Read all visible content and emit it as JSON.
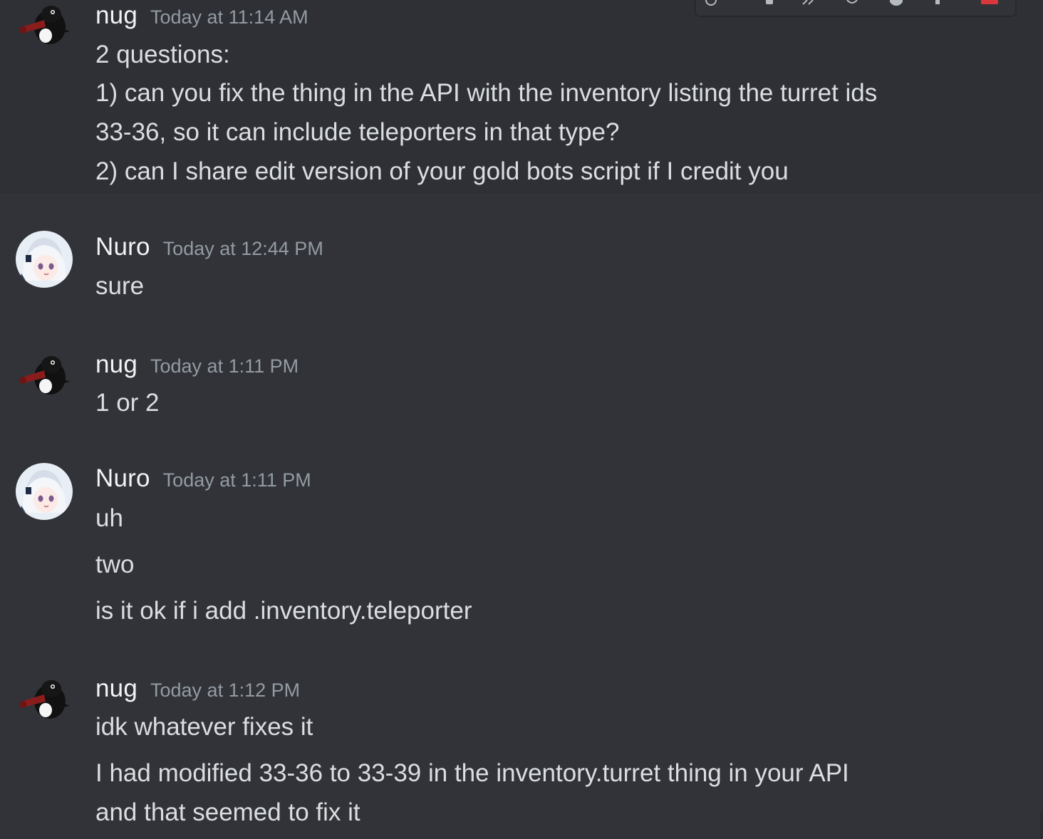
{
  "messages": [
    {
      "author": "nug",
      "timestamp": "Today at 11:14 AM",
      "lines": [
        "2 questions:",
        "1) can you fix the thing in the API with the inventory listing the turret ids",
        "33-36, so it can include teleporters in that type?",
        "2) can I share edit version of your gold bots script if I credit you"
      ]
    },
    {
      "author": "Nuro",
      "timestamp": "Today at 12:44 PM",
      "lines": [
        "sure"
      ]
    },
    {
      "author": "nug",
      "timestamp": "Today at 1:11 PM",
      "lines": [
        "1 or 2"
      ]
    },
    {
      "author": "Nuro",
      "timestamp": "Today at 1:11 PM",
      "lines": [
        "uh",
        "two",
        "is it ok if i add .inventory.teleporter"
      ]
    },
    {
      "author": "nug",
      "timestamp": "Today at 1:12 PM",
      "lines": [
        "idk whatever fixes it",
        "I had modified 33-36 to 33-39 in the inventory.turret thing in your API",
        "and that seemed to fix it"
      ]
    }
  ],
  "icons": {
    "nug_avatar": "penguin-avatar-icon",
    "nuro_avatar": "anime-girl-avatar-icon",
    "toolbar": [
      "add-reaction-icon",
      "edit-icon",
      "thread-icon",
      "reply-icon",
      "more-icon",
      "delete-icon"
    ]
  },
  "colors": {
    "background": "#313338",
    "hover_background": "#2e3035",
    "username": "#f2f3f5",
    "timestamp": "#949ba4",
    "text": "#dbdee1",
    "danger": "#da373c"
  }
}
